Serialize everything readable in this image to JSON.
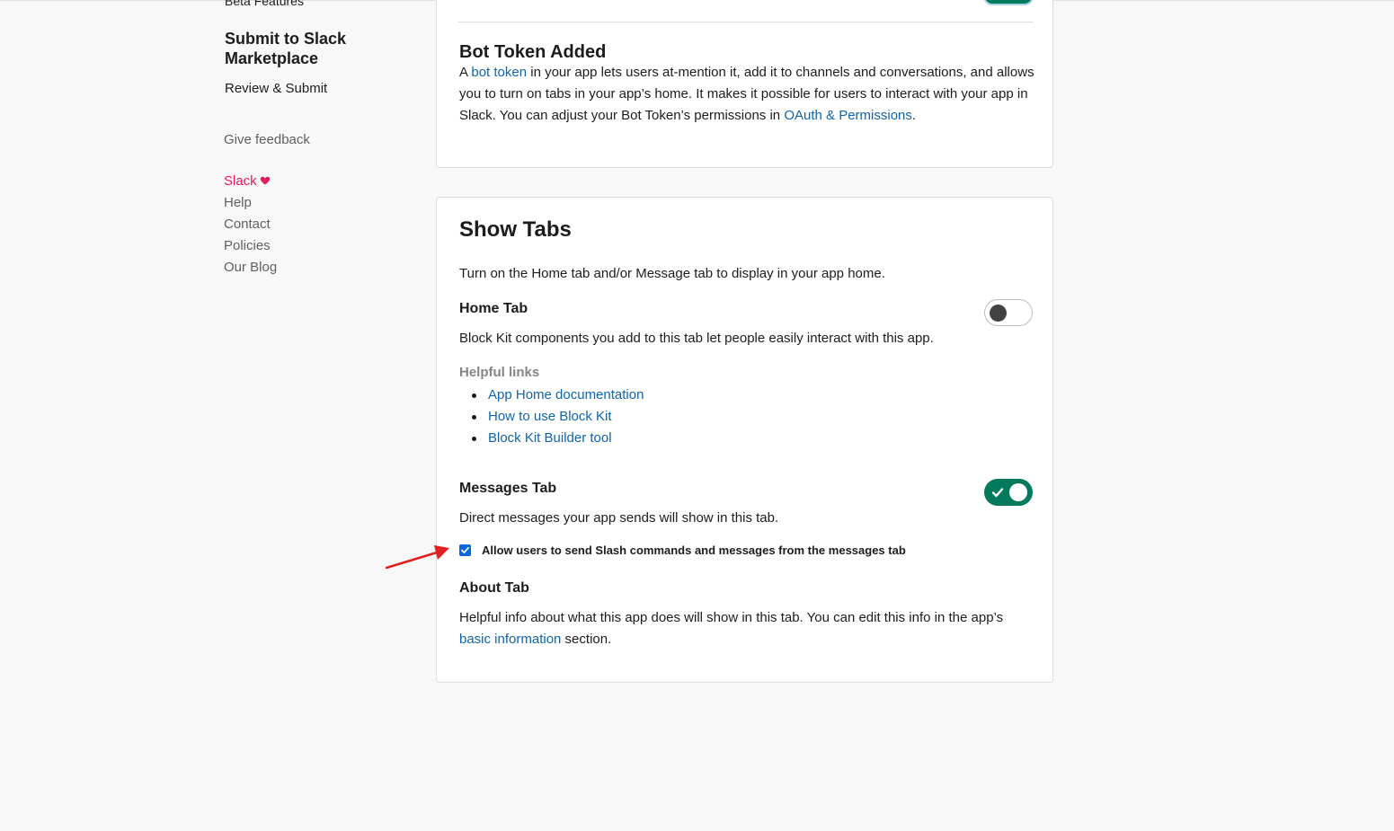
{
  "sidebar": {
    "beta_features": "Beta Features",
    "submit_heading": "Submit to Slack Marketplace",
    "review_submit": "Review & Submit",
    "give_feedback": "Give feedback",
    "links": [
      "Slack",
      "Help",
      "Contact",
      "Policies",
      "Our Blog"
    ]
  },
  "bot_token": {
    "title": "Bot Token Added",
    "text_1": "A ",
    "link_bot_token": "bot token",
    "text_2": " in your app lets users at-mention it, add it to channels and conversations, and allows you to turn on tabs in your app’s home. It makes it possible for users to interact with your app in Slack. You can adjust your Bot Token’s permissions in ",
    "link_oauth": "OAuth & Permissions",
    "text_3": "."
  },
  "show_tabs": {
    "title": "Show Tabs",
    "intro": "Turn on the Home tab and/or Message tab to display in your app home.",
    "home_tab": {
      "title": "Home Tab",
      "description": "Block Kit components you add to this tab let people easily interact with this app.",
      "enabled": false
    },
    "helpful_links": {
      "label": "Helpful links",
      "items": [
        "App Home documentation",
        "How to use Block Kit",
        "Block Kit Builder tool"
      ]
    },
    "messages_tab": {
      "title": "Messages Tab",
      "description": "Direct messages your app sends will show in this tab.",
      "enabled": true,
      "checkbox_label": "Allow users to send Slash commands and messages from the messages tab",
      "checkbox_checked": true
    },
    "about_tab": {
      "title": "About Tab",
      "text_1": "Helpful info about what this app does will show in this tab. You can edit this info in the app’s ",
      "link": "basic information",
      "text_2": " section."
    }
  },
  "colors": {
    "link": "#1264a3",
    "toggle_on": "#007a5a",
    "slack_pink": "#e01e5a",
    "annotation_arrow": "#e02020"
  }
}
